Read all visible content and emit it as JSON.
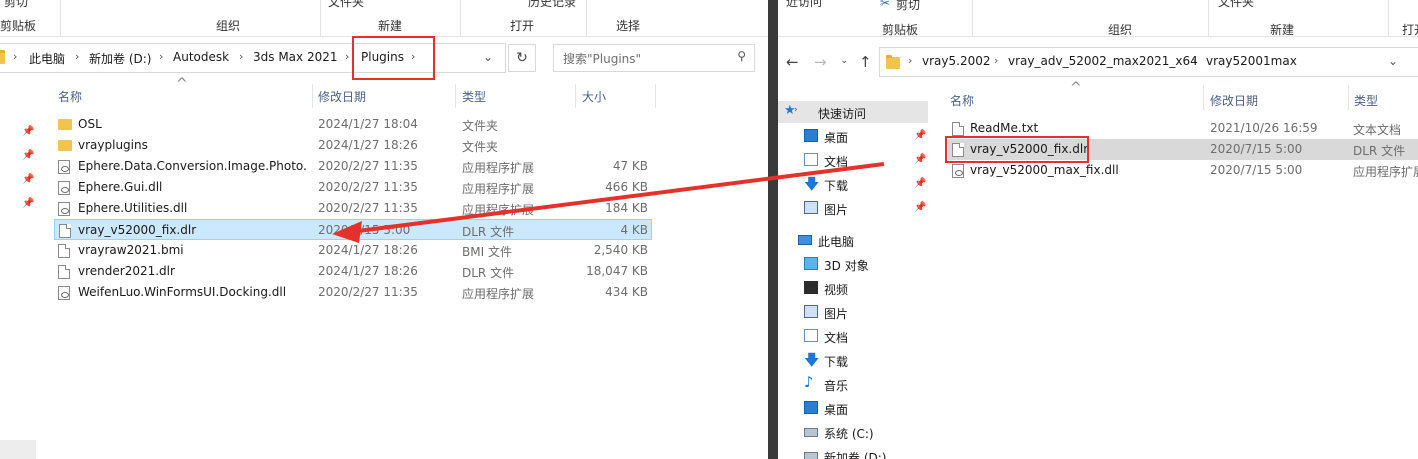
{
  "left": {
    "ribbon": {
      "frag_cut": "剪切",
      "frag_file": "文件夹",
      "frag_props": "历史记录",
      "groups": [
        "剪贴板",
        "组织",
        "新建",
        "打开",
        "选择"
      ]
    },
    "address": {
      "crumbs": [
        "此电脑",
        "新加卷 (D:)",
        "Autodesk",
        "3ds Max 2021",
        "Plugins"
      ],
      "search_placeholder": "搜索\"Plugins\""
    },
    "columns": {
      "name": "名称",
      "date": "修改日期",
      "type": "类型",
      "size": "大小"
    },
    "files": [
      {
        "name": "OSL",
        "date": "2024/1/27 18:04",
        "type": "文件夹",
        "size": "",
        "icon": "folder"
      },
      {
        "name": "vrayplugins",
        "date": "2024/1/27 18:26",
        "type": "文件夹",
        "size": "",
        "icon": "folder"
      },
      {
        "name": "Ephere.Data.Conversion.Image.Photo...",
        "date": "2020/2/27 11:35",
        "type": "应用程序扩展",
        "size": "47 KB",
        "icon": "dll"
      },
      {
        "name": "Ephere.Gui.dll",
        "date": "2020/2/27 11:35",
        "type": "应用程序扩展",
        "size": "466 KB",
        "icon": "dll"
      },
      {
        "name": "Ephere.Utilities.dll",
        "date": "2020/2/27 11:35",
        "type": "应用程序扩展",
        "size": "184 KB",
        "icon": "dll"
      },
      {
        "name": "vray_v52000_fix.dlr",
        "date": "2020/7/15 5:00",
        "type": "DLR 文件",
        "size": "4 KB",
        "icon": "file"
      },
      {
        "name": "vrayraw2021.bmi",
        "date": "2024/1/27 18:26",
        "type": "BMI 文件",
        "size": "2,540 KB",
        "icon": "file"
      },
      {
        "name": "vrender2021.dlr",
        "date": "2024/1/27 18:26",
        "type": "DLR 文件",
        "size": "18,047 KB",
        "icon": "file"
      },
      {
        "name": "WeifenLuo.WinFormsUI.Docking.dll",
        "date": "2020/2/27 11:35",
        "type": "应用程序扩展",
        "size": "434 KB",
        "icon": "dll"
      }
    ]
  },
  "right": {
    "ribbon": {
      "frag_recent": "近访问",
      "frag_cut": "剪切",
      "frag_file": "文件夹",
      "groups": [
        "剪贴板",
        "组织",
        "新建",
        "打开"
      ]
    },
    "address": {
      "crumbs": [
        "vray5.2002",
        "vray_adv_52002_max2021_x64",
        "vray52001max"
      ]
    },
    "columns": {
      "name": "名称",
      "date": "修改日期",
      "type": "类型"
    },
    "files": [
      {
        "name": "ReadMe.txt",
        "date": "2021/10/26 16:59",
        "type": "文本文档",
        "icon": "file"
      },
      {
        "name": "vray_v52000_fix.dlr",
        "date": "2020/7/15 5:00",
        "type": "DLR 文件",
        "icon": "file"
      },
      {
        "name": "vray_v52000_max_fix.dll",
        "date": "2020/7/15 5:00",
        "type": "应用程序扩展",
        "icon": "dll"
      }
    ],
    "nav": {
      "quick_access": "快速访问",
      "quick_items": [
        "桌面",
        "文档",
        "下载",
        "图片"
      ],
      "this_pc": "此电脑",
      "pc_items": [
        "3D 对象",
        "视频",
        "图片",
        "文档",
        "下载",
        "音乐",
        "桌面",
        "系统 (C:)",
        "新加卷 (D:)"
      ]
    }
  },
  "colors": {
    "selection": "#cce8ff",
    "highlight_red": "#e5312b",
    "folder_yellow": "#f0c44f"
  }
}
